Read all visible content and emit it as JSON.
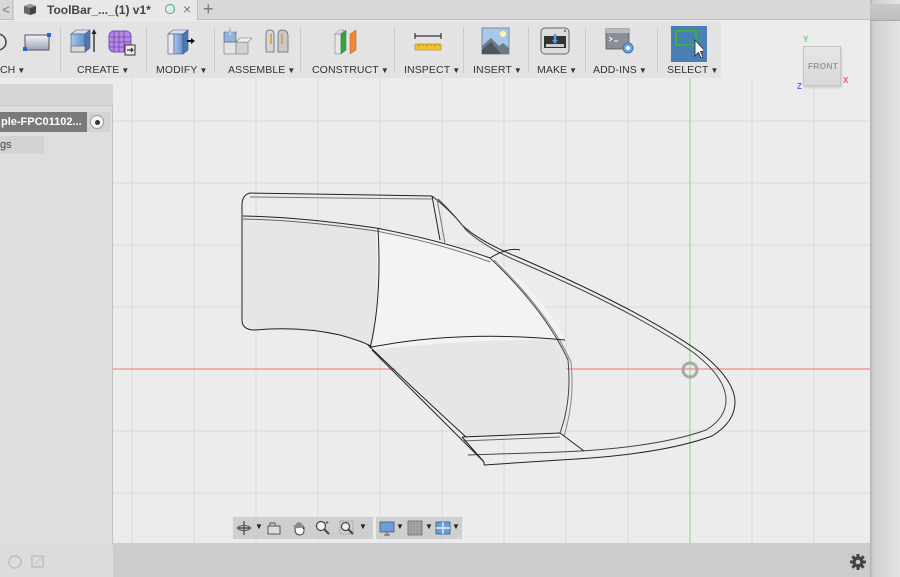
{
  "tab": {
    "nav_arrow": "<",
    "title": "ToolBar_..._(1) v1*",
    "close": "×",
    "add": "+"
  },
  "toolbar": {
    "groups": [
      {
        "label": "CH",
        "icon": "sketch-icon"
      },
      {
        "label": "CREATE",
        "icon": "extrude-icon"
      },
      {
        "label": "MODIFY",
        "icon": "press-pull-icon"
      },
      {
        "label": "ASSEMBLE",
        "icon": "new-component-icon"
      },
      {
        "label": "CONSTRUCT",
        "icon": "offset-plane-icon"
      },
      {
        "label": "INSPECT",
        "icon": "measure-icon"
      },
      {
        "label": "INSERT",
        "icon": "insert-image-icon"
      },
      {
        "label": "MAKE",
        "icon": "3d-print-icon"
      },
      {
        "label": "ADD-INS",
        "icon": "scripts-addins-icon"
      },
      {
        "label": "SELECT",
        "icon": "select-window-icon",
        "active": true
      }
    ],
    "caret": "▼"
  },
  "browser": {
    "document_name": "ple-FPC01102...",
    "row2_label": "gs"
  },
  "viewcube": {
    "face": "FRONT",
    "axis_x": "X",
    "axis_y": "Y",
    "axis_z": "Z"
  },
  "navbar": {
    "items": [
      "orbit",
      "look-at",
      "pan",
      "zoom",
      "zoom-window",
      "display-settings",
      "grid-settings",
      "viewports"
    ],
    "caret": "▼"
  },
  "colors": {
    "accent_select": "#4a7fb3",
    "axis_x": "#f08080",
    "axis_y": "#8ee28e",
    "status_saved": "#3bb08f"
  }
}
